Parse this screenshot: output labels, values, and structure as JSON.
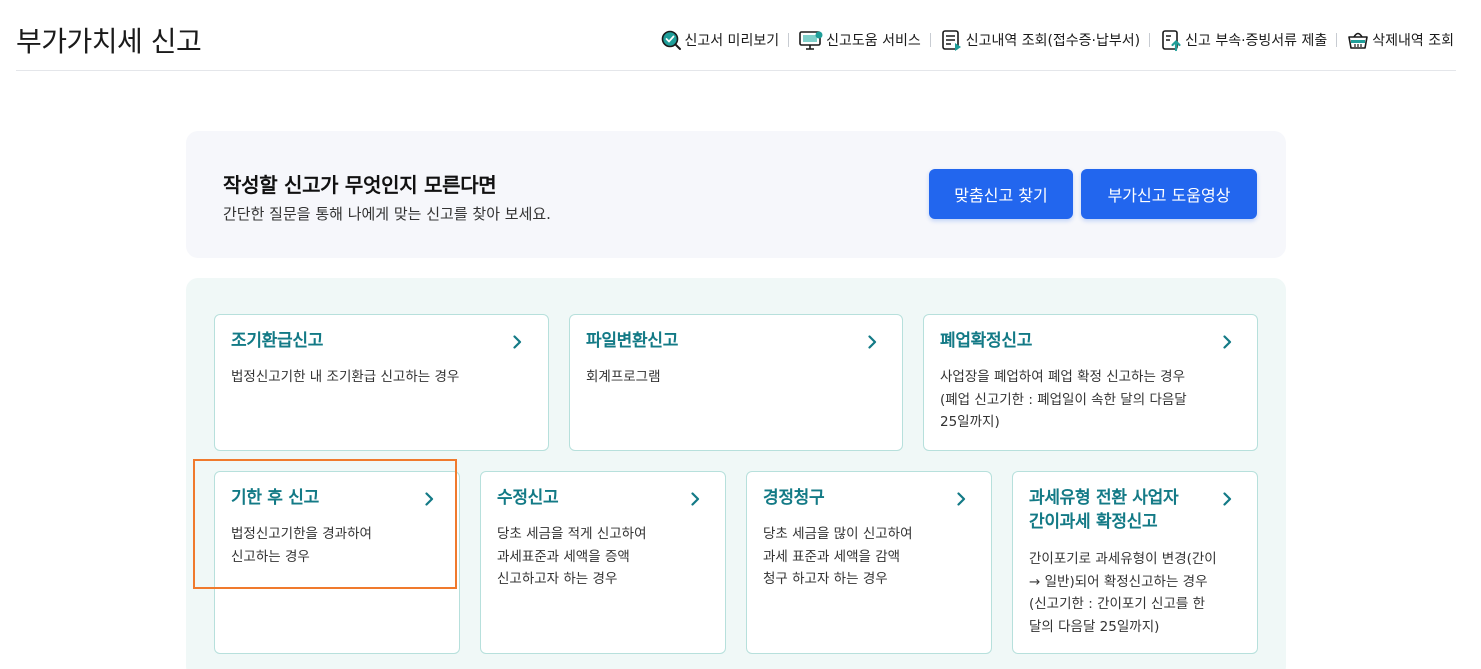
{
  "header": {
    "title": "부가가치세 신고",
    "menu": [
      {
        "label": "신고서 미리보기",
        "icon": "search-check-icon"
      },
      {
        "label": "신고도움 서비스",
        "icon": "monitor-help-icon"
      },
      {
        "label": "신고내역 조회(접수증·납부서)",
        "icon": "document-list-icon"
      },
      {
        "label": "신고 부속·증빙서류 제출",
        "icon": "document-upload-icon"
      },
      {
        "label": "삭제내역 조회",
        "icon": "trash-basket-icon"
      }
    ]
  },
  "guide": {
    "title": "작성할 신고가 무엇인지 모른다면",
    "subtitle": "간단한 질문을 통해 나에게 맞는 신고를 찾아 보세요.",
    "find_button": "맞춤신고 찾기",
    "video_button": "부가신고 도움영상"
  },
  "cards": [
    {
      "title": "조기환급신고",
      "desc": [
        "법정신고기한 내 조기환급 신고하는 경우"
      ]
    },
    {
      "title": "파일변환신고",
      "desc": [
        "회계프로그램"
      ]
    },
    {
      "title": "폐업확정신고",
      "desc": [
        "사업장을 폐업하여 폐업 확정 신고하는 경우",
        "(폐업 신고기한 : 폐업일이 속한 달의 다음달",
        "25일까지)"
      ]
    },
    {
      "title": "기한 후 신고",
      "desc": [
        "법정신고기한을 경과하여",
        "신고하는 경우"
      ]
    },
    {
      "title": "수정신고",
      "desc": [
        "당초 세금을 적게 신고하여",
        "과세표준과 세액을 증액",
        "신고하고자 하는 경우"
      ]
    },
    {
      "title": "경정청구",
      "desc": [
        "당초 세금을 많이 신고하여",
        "과세 표준과 세액을 감액",
        "청구 하고자 하는 경우"
      ]
    },
    {
      "title": [
        "과세유형 전환 사업자",
        "간이과세 확정신고"
      ],
      "desc": [
        "간이포기로 과세유형이 변경(간이",
        "→ 일반)되어 확정신고하는 경우",
        "(신고기한 : 간이포기 신고를 한",
        "달의 다음달 25일까지)"
      ]
    }
  ],
  "colors": {
    "accent": "#2266ee",
    "card_title": "#137a86",
    "card_border": "#b7e0dc",
    "panel_bg": "#f0f8f7",
    "highlight": "#f07a2d"
  }
}
